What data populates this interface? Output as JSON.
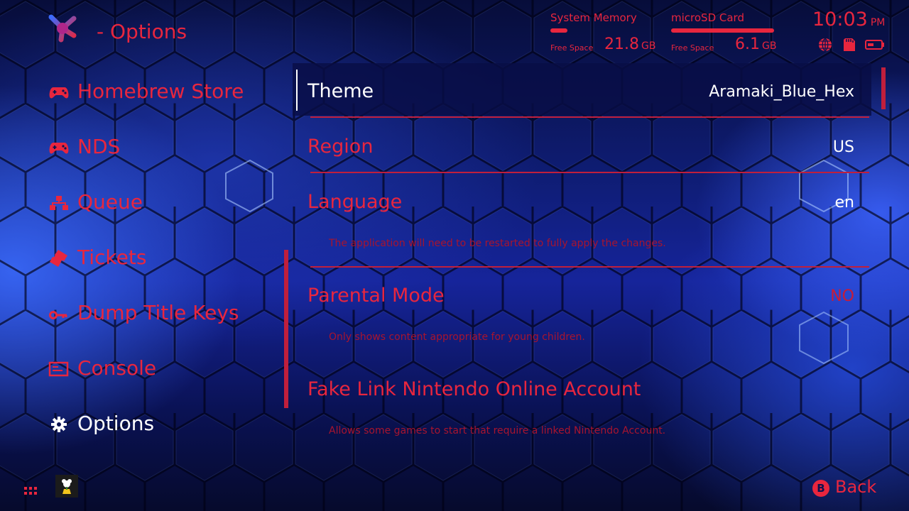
{
  "header": {
    "title": "- Options",
    "system_memory": {
      "label": "System Memory",
      "free_label": "Free Space",
      "value": "21.8",
      "unit": "GB",
      "used_fraction": 0.1
    },
    "sd_card": {
      "label": "microSD Card",
      "free_label": "Free Space",
      "value": "6.1",
      "unit": "GB",
      "used_fraction": 0.97
    },
    "clock": {
      "time": "10:03",
      "ampm": "PM"
    },
    "status_icons": [
      "globe-icon",
      "sd-card-icon",
      "battery-icon"
    ]
  },
  "sidebar": {
    "items": [
      {
        "label": "Homebrew Store",
        "icon": "gamepad-icon",
        "active": false
      },
      {
        "label": "NDS",
        "icon": "gamepad-icon",
        "active": false
      },
      {
        "label": "Queue",
        "icon": "queue-icon",
        "active": false
      },
      {
        "label": "Tickets",
        "icon": "ticket-icon",
        "active": false
      },
      {
        "label": "Dump Title Keys",
        "icon": "key-icon",
        "active": false
      },
      {
        "label": "Console",
        "icon": "console-icon",
        "active": false
      },
      {
        "label": "Options",
        "icon": "gear-icon",
        "active": true
      }
    ]
  },
  "settings": [
    {
      "label": "Theme",
      "value": "Aramaki_Blue_Hex",
      "description": ""
    },
    {
      "label": "Region",
      "value": "US",
      "description": ""
    },
    {
      "label": "Language",
      "value": "en",
      "description": "The application will need to be restarted to fully apply the changes."
    },
    {
      "label": "Parental Mode",
      "value": "NO",
      "description": "Only shows content appropriate for young children."
    },
    {
      "label": "Fake Link Nintendo Online Account",
      "value": "",
      "description": "Allows some games to start that require a linked Nintendo Account."
    }
  ],
  "footer": {
    "back_button_glyph": "B",
    "back_label": "Back"
  },
  "colors": {
    "accent": "#e8263e",
    "background": "#0f1d75",
    "selected_row": "#080e46"
  }
}
